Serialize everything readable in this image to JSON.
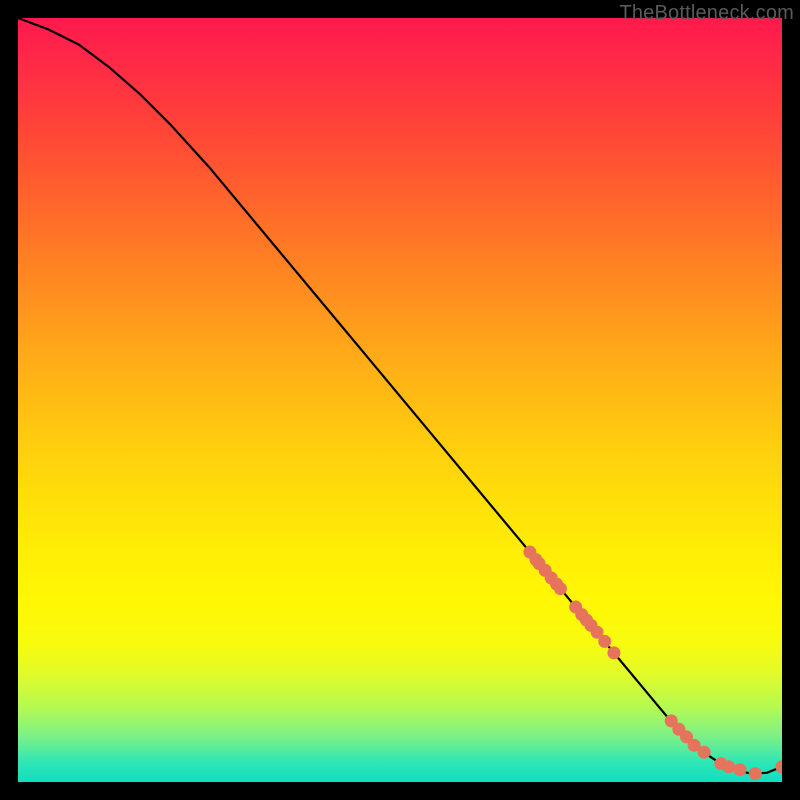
{
  "watermark": "TheBottleneck.com",
  "chart_data": {
    "type": "line",
    "title": "",
    "xlabel": "",
    "ylabel": "",
    "xlim": [
      0,
      100
    ],
    "ylim": [
      0,
      100
    ],
    "grid": false,
    "legend": false,
    "series": [
      {
        "name": "curve",
        "style": "line",
        "color": "#000000",
        "x": [
          0,
          4,
          8,
          12,
          16,
          20,
          25,
          30,
          35,
          40,
          45,
          50,
          55,
          60,
          65,
          70,
          74,
          78,
          82,
          85,
          88,
          90,
          92,
          94,
          96,
          98,
          100
        ],
        "y": [
          100,
          98.5,
          96.5,
          93.5,
          90,
          86,
          80.5,
          74.5,
          68.5,
          62.5,
          56.5,
          50.5,
          44.5,
          38.5,
          32.5,
          26.5,
          21.7,
          16.9,
          12.1,
          8.5,
          5.3,
          3.7,
          2.4,
          1.5,
          1.1,
          1.2,
          2.0
        ]
      },
      {
        "name": "markers",
        "style": "scatter",
        "color": "#e6735c",
        "x": [
          67.0,
          67.8,
          68.2,
          69.0,
          69.8,
          70.5,
          71.0,
          73.0,
          73.8,
          74.4,
          75.0,
          75.8,
          76.8,
          78.0,
          85.5,
          86.5,
          87.5,
          88.5,
          89.8,
          92.0,
          93.0,
          94.5,
          96.5,
          100.0
        ],
        "y": [
          30.1,
          29.1,
          28.6,
          27.7,
          26.7,
          25.9,
          25.3,
          22.9,
          21.9,
          21.2,
          20.5,
          19.6,
          18.4,
          16.9,
          8.0,
          6.9,
          5.9,
          4.8,
          3.9,
          2.4,
          2.0,
          1.6,
          1.1,
          2.0
        ]
      }
    ]
  }
}
